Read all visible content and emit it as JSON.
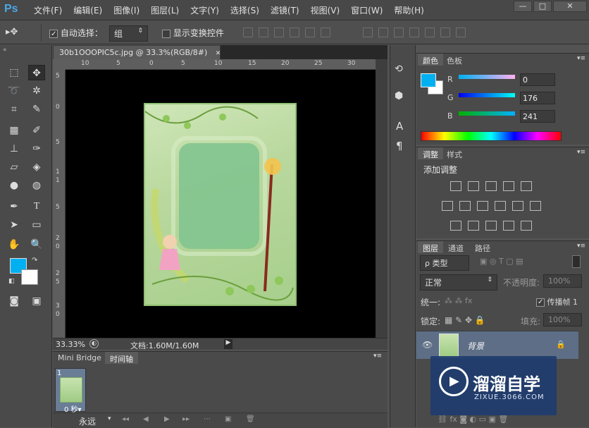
{
  "app": {
    "logo": "Ps"
  },
  "menu": [
    "文件(F)",
    "编辑(E)",
    "图像(I)",
    "图层(L)",
    "文字(Y)",
    "选择(S)",
    "滤镜(T)",
    "视图(V)",
    "窗口(W)",
    "帮助(H)"
  ],
  "window_controls": {
    "minimize": "—",
    "restore": "□",
    "close": "✕"
  },
  "options": {
    "auto_select_label": "自动选择：",
    "auto_select_checked": true,
    "auto_select_value": "组",
    "show_transform_label": "显示变换控件",
    "show_transform_checked": false
  },
  "document": {
    "tab_title": "30b1OOOPIC5c.jpg @ 33.3%(RGB/8#)",
    "close": "✕",
    "ruler_h": [
      "10",
      "5",
      "0",
      "5",
      "10",
      "15",
      "20",
      "25",
      "30"
    ],
    "ruler_v": [
      "5",
      "0",
      "5",
      "1",
      "1",
      "5",
      "2",
      "0",
      "2",
      "5",
      "3",
      "0"
    ],
    "zoom": "33.33%",
    "doc_info": "文档:1.60M/1.60M"
  },
  "timeline": {
    "tabs": [
      "Mini Bridge",
      "时间轴"
    ],
    "active_tab": "时间轴",
    "frame_number": "1",
    "frame_delay": "0 秒▾",
    "loop": "永远"
  },
  "color_panel": {
    "tabs": [
      "颜色",
      "色板"
    ],
    "active_tab": "颜色",
    "r_label": "R",
    "g_label": "G",
    "b_label": "B",
    "r": "0",
    "g": "176",
    "b": "241",
    "foreground": "#00b0f1",
    "background": "#ffffff"
  },
  "adjust_panel": {
    "tabs": [
      "调整",
      "样式"
    ],
    "active_tab": "调整",
    "title": "添加调整"
  },
  "layers_panel": {
    "tabs": [
      "图层",
      "通道",
      "路径"
    ],
    "active_tab": "图层",
    "filter_kind": "ρ 类型",
    "blend_mode": "正常",
    "opacity_label": "不透明度:",
    "opacity_value": "100%",
    "unify_label": "统一:",
    "propagate_label": "传播帧 1",
    "lock_label": "锁定:",
    "fill_label": "填充:",
    "fill_value": "100%",
    "layer_name": "背景"
  },
  "watermark": {
    "brand": "溜溜自学",
    "url": "ZIXUE.3066.COM"
  }
}
